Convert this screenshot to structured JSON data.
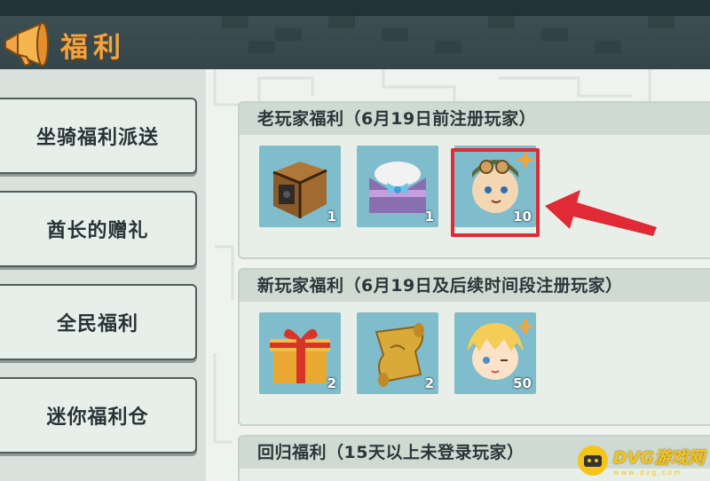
{
  "header": {
    "title": "福利"
  },
  "sidebar": {
    "items": [
      {
        "label": "坐骑福利派送"
      },
      {
        "label": "酋长的赠礼"
      },
      {
        "label": "全民福利"
      },
      {
        "label": "迷你福利仓"
      }
    ]
  },
  "sections": [
    {
      "title": "老玩家福利（6月19日前注册玩家）",
      "items": [
        {
          "icon": "treasure-crate-icon",
          "count": "1"
        },
        {
          "icon": "envelope-bow-icon",
          "count": "1"
        },
        {
          "icon": "pilot-character-avatar-icon",
          "count": "10"
        }
      ]
    },
    {
      "title": "新玩家福利（6月19日及后续时间段注册玩家）",
      "items": [
        {
          "icon": "gift-box-icon",
          "count": "2"
        },
        {
          "icon": "scroll-icon",
          "count": "2"
        },
        {
          "icon": "blonde-character-avatar-icon",
          "count": "50"
        }
      ]
    },
    {
      "title": "回归福利（15天以上未登录玩家）"
    }
  ],
  "watermark": {
    "name": "DVG游戏网",
    "url": "www.dvg.com"
  },
  "colors": {
    "title_orange": "#f0a443",
    "highlight_red": "#e02a36",
    "item_bg": "#7fbccc",
    "watermark_yellow": "#f5c51a"
  }
}
